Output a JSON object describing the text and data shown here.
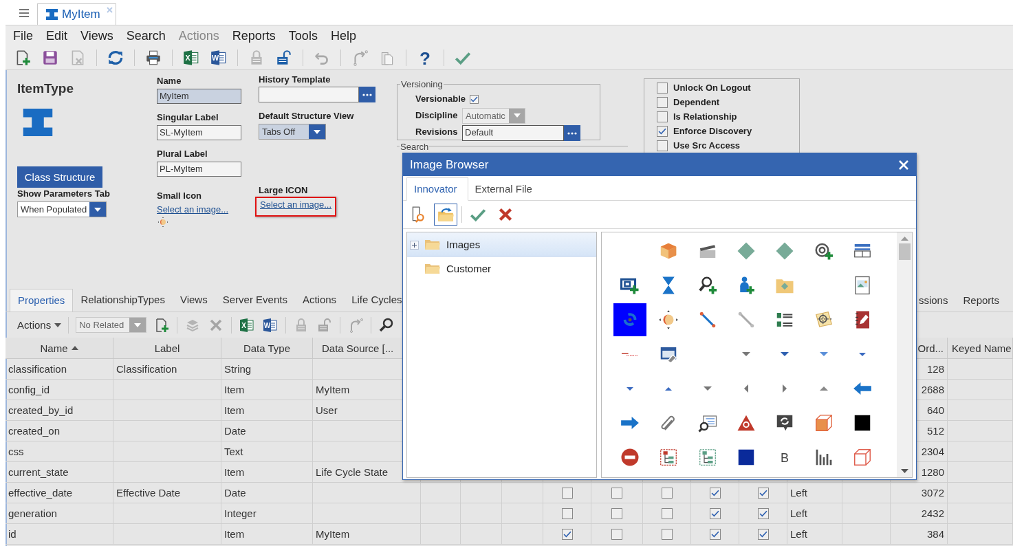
{
  "app_tabs": [
    {
      "label": "MyItem",
      "selected": true
    }
  ],
  "menu": [
    {
      "label": "File",
      "disabled": false
    },
    {
      "label": "Edit",
      "disabled": false
    },
    {
      "label": "Views",
      "disabled": false
    },
    {
      "label": "Search",
      "disabled": false
    },
    {
      "label": "Actions",
      "disabled": true
    },
    {
      "label": "Reports",
      "disabled": false
    },
    {
      "label": "Tools",
      "disabled": false
    },
    {
      "label": "Help",
      "disabled": false
    }
  ],
  "toolbar": [
    {
      "kind": "new",
      "disabled": false
    },
    {
      "kind": "save",
      "disabled": false
    },
    {
      "kind": "delete",
      "disabled": true
    },
    {
      "kind": "refresh",
      "disabled": false
    },
    {
      "kind": "print",
      "disabled": false
    },
    {
      "kind": "excel",
      "glyph": "X",
      "disabled": false
    },
    {
      "kind": "word",
      "glyph": "W",
      "disabled": false
    },
    {
      "kind": "lock",
      "disabled": true
    },
    {
      "kind": "unlock",
      "disabled": false
    },
    {
      "kind": "undo",
      "disabled": true
    },
    {
      "kind": "redo",
      "disabled": true
    },
    {
      "kind": "paste",
      "disabled": true
    },
    {
      "kind": "help",
      "glyph": "?",
      "disabled": false
    },
    {
      "kind": "check",
      "disabled": false
    }
  ],
  "form": {
    "heading": "ItemType",
    "class_structure": "Class Structure",
    "show_parameters_tab": {
      "label": "Show Parameters Tab",
      "value": "When Populated"
    },
    "name": {
      "label": "Name",
      "value": "MyItem"
    },
    "singular_label": {
      "label": "Singular Label",
      "value": "SL-MyItem"
    },
    "plural_label": {
      "label": "Plural Label",
      "value": "PL-MyItem"
    },
    "small_icon": {
      "label": "Small Icon",
      "link": "Select an image..."
    },
    "history_template": {
      "label": "History Template"
    },
    "default_structure_view": {
      "label": "Default Structure View",
      "value": "Tabs Off"
    },
    "large_icon": {
      "label": "Large ICON",
      "link": "Select an image...",
      "highlighted": true
    },
    "versioning": {
      "legend": "Versioning",
      "versionable": {
        "label": "Versionable",
        "checked": true
      },
      "discipline": {
        "label": "Discipline",
        "value": "Automatic",
        "disabled": true
      },
      "revisions": {
        "label": "Revisions",
        "value": "Default"
      }
    },
    "search_legend": "Search",
    "options": [
      {
        "label": "Unlock On Logout",
        "checked": false
      },
      {
        "label": "Dependent",
        "checked": false
      },
      {
        "label": "Is Relationship",
        "checked": false
      },
      {
        "label": "Enforce Discovery",
        "checked": true
      },
      {
        "label": "Use Src Access",
        "checked": false
      }
    ]
  },
  "relationship_tabs": [
    {
      "label": "Properties",
      "selected": true
    },
    {
      "label": "RelationshipTypes",
      "selected": false
    },
    {
      "label": "Views",
      "selected": false
    },
    {
      "label": "Server Events",
      "selected": false
    },
    {
      "label": "Actions",
      "selected": false
    },
    {
      "label": "Life Cycles",
      "selected": false
    }
  ],
  "relationship_tabs_right": [
    {
      "label": "ssions",
      "selected": false
    },
    {
      "label": "Reports",
      "selected": false
    }
  ],
  "grid_toolbar": {
    "actions": "Actions",
    "related": {
      "value": "No Related",
      "disabled": true
    },
    "buttons": [
      {
        "kind": "new",
        "disabled": false
      },
      {
        "kind": "pick",
        "disabled": true
      },
      {
        "kind": "x",
        "disabled": true
      },
      {
        "kind": "excel",
        "glyph": "X",
        "disabled": false
      },
      {
        "kind": "word",
        "glyph": "W",
        "disabled": false
      },
      {
        "kind": "lock",
        "disabled": true
      },
      {
        "kind": "unlock",
        "disabled": true
      },
      {
        "kind": "redo",
        "disabled": true
      },
      {
        "kind": "search",
        "disabled": false
      }
    ]
  },
  "table": {
    "columns": [
      {
        "label": "Name",
        "sort_ascending": true
      },
      {
        "label": "Label"
      },
      {
        "label": "Data Type"
      },
      {
        "label": "Data Source [..."
      },
      {
        "label": "Ord..."
      },
      {
        "label": "Keyed Name"
      }
    ],
    "rows": [
      {
        "name": "classification",
        "label": "Classification",
        "data_type": "String",
        "order": "128"
      },
      {
        "name": "config_id",
        "data_type": "Item",
        "data_source": "MyItem",
        "order": "2688"
      },
      {
        "name": "created_by_id",
        "data_type": "Item",
        "data_source": "User",
        "order": "640"
      },
      {
        "name": "created_on",
        "data_type": "Date",
        "order": "512"
      },
      {
        "name": "css",
        "data_type": "Text",
        "order": "2304"
      },
      {
        "name": "current_state",
        "data_type": "Item",
        "data_source": "Life Cycle State",
        "order": "1280"
      },
      {
        "name": "effective_date",
        "label": "Effective Date",
        "data_type": "Date",
        "checks": [
          false,
          false,
          false,
          true,
          true
        ],
        "alignment": "Left",
        "order": "3072"
      },
      {
        "name": "generation",
        "data_type": "Integer",
        "checks": [
          false,
          false,
          false,
          true,
          true
        ],
        "alignment": "Left",
        "order": "2432"
      },
      {
        "name": "id",
        "data_type": "Item",
        "data_source": "MyItem",
        "checks": [
          true,
          false,
          false,
          true,
          true
        ],
        "alignment": "Left",
        "order": "384"
      }
    ]
  },
  "dialog": {
    "title": "Image Browser",
    "tabs": [
      {
        "label": "Innovator",
        "selected": true
      },
      {
        "label": "External File",
        "selected": false
      }
    ],
    "toolbar": [
      {
        "kind": "find",
        "selected": false
      },
      {
        "kind": "folder-refresh",
        "selected": true
      },
      {
        "kind": "accept",
        "selected": false
      },
      {
        "kind": "cancel",
        "selected": false
      }
    ],
    "folders": [
      {
        "label": "Images",
        "selected": true,
        "expanded": false
      },
      {
        "label": "Customer",
        "selected": false
      }
    ],
    "images": [
      {
        "kind": "blank",
        "selected": false
      },
      {
        "kind": "cube",
        "selected": false
      },
      {
        "kind": "clapper",
        "selected": false
      },
      {
        "kind": "diamond",
        "selected": false
      },
      {
        "kind": "diamond",
        "selected": false
      },
      {
        "kind": "at-plus",
        "selected": false
      },
      {
        "kind": "table-layout",
        "selected": false
      },
      {
        "kind": "screen-plus",
        "selected": false
      },
      {
        "kind": "hourglass",
        "selected": false
      },
      {
        "kind": "search-plus",
        "selected": false
      },
      {
        "kind": "user-plus",
        "selected": false
      },
      {
        "kind": "folder-diamond",
        "selected": false
      },
      {
        "kind": "blank",
        "selected": false
      },
      {
        "kind": "picture",
        "selected": false
      },
      {
        "kind": "swirl",
        "selected": true
      },
      {
        "kind": "orbit",
        "selected": false
      },
      {
        "kind": "blue-line",
        "selected": false
      },
      {
        "kind": "grey-line",
        "selected": false
      },
      {
        "kind": "ab-list",
        "selected": false
      },
      {
        "kind": "target-map",
        "selected": false
      },
      {
        "kind": "notebook",
        "selected": false
      },
      {
        "kind": "scribble",
        "selected": false
      },
      {
        "kind": "window-pen",
        "selected": false
      },
      {
        "kind": "blank",
        "selected": false
      },
      {
        "kind": "caret-down-grey",
        "selected": false
      },
      {
        "kind": "caret-down-blue",
        "selected": false
      },
      {
        "kind": "caret-down-light",
        "selected": false
      },
      {
        "kind": "caret-down-small",
        "selected": false
      },
      {
        "kind": "caret-down-small",
        "selected": false
      },
      {
        "kind": "caret-up-blue",
        "selected": false
      },
      {
        "kind": "caret-down-grey",
        "selected": false
      },
      {
        "kind": "caret-left",
        "selected": false
      },
      {
        "kind": "caret-right",
        "selected": false
      },
      {
        "kind": "caret-up-grey",
        "selected": false
      },
      {
        "kind": "arrow-left",
        "selected": false
      },
      {
        "kind": "arrow-right",
        "selected": false
      },
      {
        "kind": "paperclip",
        "selected": false
      },
      {
        "kind": "search-doc",
        "selected": false
      },
      {
        "kind": "warning-search",
        "selected": false
      },
      {
        "kind": "chat-refresh",
        "selected": false
      },
      {
        "kind": "cube-outline-orange",
        "selected": false
      },
      {
        "kind": "black-square",
        "selected": false
      },
      {
        "kind": "minus-circle",
        "selected": false
      },
      {
        "kind": "tree-red",
        "selected": false
      },
      {
        "kind": "tree-green",
        "selected": false
      },
      {
        "kind": "navy-square",
        "selected": false
      },
      {
        "kind": "letter",
        "glyph": "B",
        "selected": false
      },
      {
        "kind": "bar-chart",
        "selected": false
      },
      {
        "kind": "cube-outline-red",
        "selected": false
      }
    ]
  }
}
